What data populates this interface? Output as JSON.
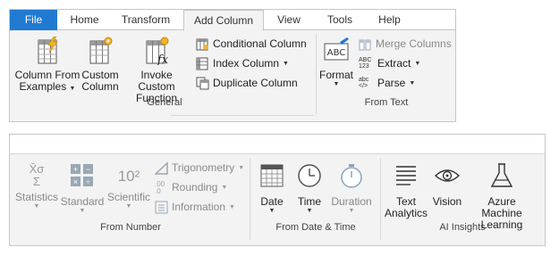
{
  "tabs": [
    {
      "label": "File"
    },
    {
      "label": "Home"
    },
    {
      "label": "Transform"
    },
    {
      "label": "Add Column"
    },
    {
      "label": "View"
    },
    {
      "label": "Tools"
    },
    {
      "label": "Help"
    }
  ],
  "general": {
    "column_from_examples": [
      "Column From",
      "Examples"
    ],
    "custom_column": [
      "Custom",
      "Column"
    ],
    "invoke_custom_function": [
      "Invoke Custom",
      "Function"
    ],
    "conditional_column": "Conditional Column",
    "index_column": "Index Column",
    "duplicate_column": "Duplicate Column",
    "group_label": "General"
  },
  "from_text": {
    "format": "Format",
    "merge_columns": "Merge Columns",
    "extract": "Extract",
    "parse": "Parse",
    "group_label": "From Text",
    "format_icon_text": "ABC",
    "extract_icon_text": [
      "ABC",
      "123"
    ],
    "parse_icon_text": "abc"
  },
  "from_number": {
    "statistics": "Statistics",
    "standard": "Standard",
    "scientific": "Scientific",
    "trigonometry": "Trigonometry",
    "rounding": "Rounding",
    "information": "Information",
    "group_label": "From Number",
    "statistics_icon_text": [
      "X̄σ",
      "Σ"
    ],
    "scientific_icon_text": "10²",
    "rounding_icon_text": ".00"
  },
  "from_date_time": {
    "date": "Date",
    "time": "Time",
    "duration": "Duration",
    "group_label": "From Date & Time"
  },
  "ai_insights": {
    "text_analytics": [
      "Text",
      "Analytics"
    ],
    "vision": "Vision",
    "azure_ml": [
      "Azure Machine",
      "Learning"
    ],
    "group_label": "AI Insights"
  },
  "colors": {
    "file_tab": "#217ad2",
    "ribbon_bg": "#f3f3f3",
    "disabled_text": "#8a8a8a"
  }
}
